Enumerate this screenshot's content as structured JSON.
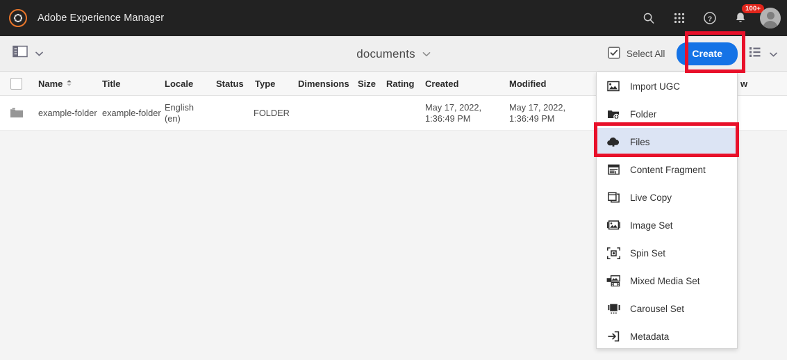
{
  "topbar": {
    "brand_title": "Adobe Experience Manager",
    "logo_icon": "aem-gear-logo",
    "icons": [
      {
        "name": "search-icon",
        "label": "Search"
      },
      {
        "name": "apps-grid-icon",
        "label": "Solutions"
      },
      {
        "name": "help-icon",
        "label": "Help"
      },
      {
        "name": "bell-icon",
        "label": "Notifications"
      }
    ],
    "notification_badge": "100+",
    "avatar_label": "User"
  },
  "toolbar": {
    "rail_toggle_icon": "rail-toggle-icon",
    "rail_chevron_icon": "chevron-down-icon",
    "page_title": "documents",
    "title_chevron_icon": "chevron-down-icon",
    "select_all_label": "Select All",
    "select_all_icon": "checkbox-checked-icon",
    "create_label": "Create",
    "view_list_icon": "list-view-icon",
    "view_chevron_icon": "chevron-down-icon"
  },
  "table": {
    "columns": [
      {
        "label": "Name",
        "sortable": true
      },
      {
        "label": "Title",
        "sortable": false
      },
      {
        "label": "Locale",
        "sortable": false
      },
      {
        "label": "Status",
        "sortable": false
      },
      {
        "label": "Type",
        "sortable": false
      },
      {
        "label": "Dimensions",
        "sortable": false
      },
      {
        "label": "Size",
        "sortable": false
      },
      {
        "label": "Rating",
        "sortable": false
      },
      {
        "label": "Created",
        "sortable": false
      },
      {
        "label": "Modified",
        "sortable": false
      },
      {
        "label": "w",
        "sortable": false
      }
    ],
    "rows": [
      {
        "icon": "folder-icon",
        "name": "example-folder",
        "title": "example-folder",
        "locale": "English (en)",
        "status": "",
        "type": "FOLDER",
        "dimensions": "",
        "size": "",
        "rating": "",
        "created": "May 17, 2022, 1:36:49 PM",
        "modified": "May 17, 2022, 1:36:49 PM"
      }
    ]
  },
  "create_menu": {
    "items": [
      {
        "label": "Import UGC",
        "icon": "import-ugc-icon",
        "selected": false
      },
      {
        "label": "Folder",
        "icon": "folder-add-icon",
        "selected": false
      },
      {
        "label": "Files",
        "icon": "cloud-upload-icon",
        "selected": true
      },
      {
        "label": "Content Fragment",
        "icon": "content-fragment-icon",
        "selected": false
      },
      {
        "label": "Live Copy",
        "icon": "live-copy-icon",
        "selected": false
      },
      {
        "label": "Image Set",
        "icon": "image-set-icon",
        "selected": false
      },
      {
        "label": "Spin Set",
        "icon": "spin-set-icon",
        "selected": false
      },
      {
        "label": "Mixed Media Set",
        "icon": "mixed-media-set-icon",
        "selected": false
      },
      {
        "label": "Carousel Set",
        "icon": "carousel-set-icon",
        "selected": false
      },
      {
        "label": "Metadata",
        "icon": "metadata-icon",
        "selected": false
      }
    ]
  },
  "highlights": [
    {
      "name": "create-button-highlight",
      "color": "#e8102a"
    },
    {
      "name": "files-menu-item-highlight",
      "color": "#e8102a"
    }
  ],
  "colors": {
    "topbar_bg": "#222222",
    "accent_orange": "#e8762b",
    "create_blue": "#1473e6",
    "badge_red": "#e1251b",
    "highlight_red": "#e8102a",
    "selected_menu_bg": "#dce4f4",
    "page_bg": "#f4f4f4"
  }
}
